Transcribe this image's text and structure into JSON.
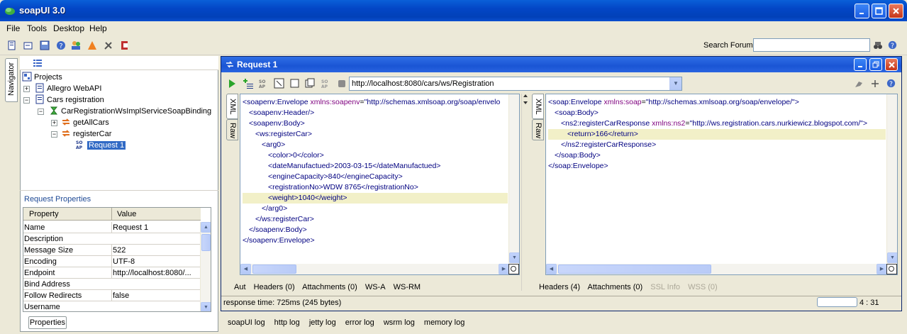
{
  "window": {
    "title": "soapUI 3.0"
  },
  "menu": [
    {
      "label": "File"
    },
    {
      "label": "Tools"
    },
    {
      "label": "Desktop"
    },
    {
      "label": "Help"
    }
  ],
  "toolbar": {
    "search_label": "Search Forum",
    "search_value": ""
  },
  "navigator": {
    "tab_label": "Navigator",
    "tree": {
      "root": "Projects",
      "project1": "Allegro WebAPI",
      "project2": "Cars registration",
      "binding": "CarRegistrationWsImplServiceSoapBinding",
      "op1": "getAllCars",
      "op2": "registerCar",
      "request": "Request 1"
    }
  },
  "request_properties": {
    "title": "Request Properties",
    "headers": [
      "Property",
      "Value"
    ],
    "rows": [
      {
        "name": "Name",
        "value": "Request 1"
      },
      {
        "name": "Description",
        "value": ""
      },
      {
        "name": "Message Size",
        "value": "522"
      },
      {
        "name": "Encoding",
        "value": "UTF-8"
      },
      {
        "name": "Endpoint",
        "value": "http://localhost:8080/..."
      },
      {
        "name": "Bind Address",
        "value": ""
      },
      {
        "name": "Follow Redirects",
        "value": "false"
      },
      {
        "name": "Username",
        "value": ""
      }
    ],
    "button_label": "Properties"
  },
  "request_window": {
    "title": "Request 1",
    "url": "http://localhost:8080/cars/ws/Registration",
    "left_tabs": {
      "xml": "XML",
      "raw": "Raw"
    },
    "right_tabs": {
      "xml": "XML",
      "raw": "Raw"
    },
    "request_bottom_tabs": {
      "aut": "Aut",
      "headers": "Headers (0)",
      "attachments": "Attachments (0)",
      "wsa": "WS-A",
      "wsrm": "WS-RM"
    },
    "response_bottom_tabs": {
      "headers": "Headers (4)",
      "attachments": "Attachments (0)",
      "ssl": "SSL Info",
      "wss": "WSS (0)"
    },
    "status": "response time: 725ms (245 bytes)",
    "cursor_pos": "4 : 31"
  },
  "request_xml": {
    "l1_tag": "<soapenv:Envelope",
    "l1_attr": "xmlns:soapenv",
    "l1_eq": "=",
    "l1_val": "\"http://schemas.xmlsoap.org/soap/envelo",
    "l2": "<soapenv:Header/>",
    "l3": "<soapenv:Body>",
    "l4": "<ws:registerCar>",
    "l5": "<arg0>",
    "l6": "<color>0</color>",
    "l7": "<dateManufactued>2003-03-15</dateManufactued>",
    "l8": "<engineCapacity>840</engineCapacity>",
    "l9": "<registrationNo>WDW 8765</registrationNo>",
    "l10": "<weight>1040</weight>",
    "l11": "</arg0>",
    "l12": "</ws:registerCar>",
    "l13": "</soapenv:Body>",
    "l14": "</soapenv:Envelope>"
  },
  "response_xml": {
    "l1_tag": "<soap:Envelope",
    "l1_attr": "xmlns:soap",
    "l1_eq": "=",
    "l1_val": "\"http://schemas.xmlsoap.org/soap/envelope/\">",
    "l2": "<soap:Body>",
    "l3_tag": "<ns2:registerCarResponse",
    "l3_attr": "xmlns:ns2",
    "l3_eq": "=",
    "l3_val": "\"http://ws.registration.cars.nurkiewicz.blogspot.com/\">",
    "l4": "<return>166</return>",
    "l5": "</ns2:registerCarResponse>",
    "l6": "</soap:Body>",
    "l7": "</soap:Envelope>"
  },
  "logs": [
    {
      "label": "soapUI log"
    },
    {
      "label": "http log"
    },
    {
      "label": "jetty log"
    },
    {
      "label": "error log"
    },
    {
      "label": "wsrm log"
    },
    {
      "label": "memory log"
    }
  ]
}
